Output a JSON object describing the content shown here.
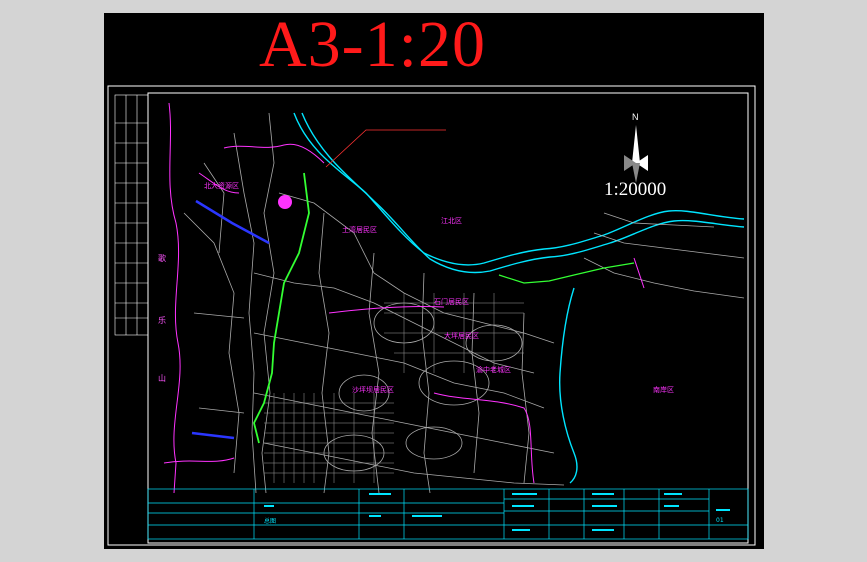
{
  "sheet": {
    "title": "A3-1:20",
    "scale": "1:20000",
    "north_letter": "N"
  },
  "map_labels": {
    "district_ne": "江北区",
    "district_e": "南岸区",
    "mountain_chars": [
      "歌",
      "乐",
      "山"
    ],
    "zone_labels": [
      {
        "text": "北大资源区"
      },
      {
        "text": "土湾居民区"
      },
      {
        "text": "石门居民区"
      },
      {
        "text": "沙坪坝居民区"
      },
      {
        "text": "渝中老城区"
      },
      {
        "text": "大坪居民区"
      }
    ]
  },
  "colors": {
    "frame": "#ffffff",
    "title_block": "#00e5ff",
    "roads": "#bdbdbd",
    "river": "#00e5ff",
    "green_route": "#33ff33",
    "boundary": "#ff33ff",
    "title_text": "#ff1a1a"
  },
  "title_block": {
    "project": "总图",
    "drawing_no": "01"
  }
}
